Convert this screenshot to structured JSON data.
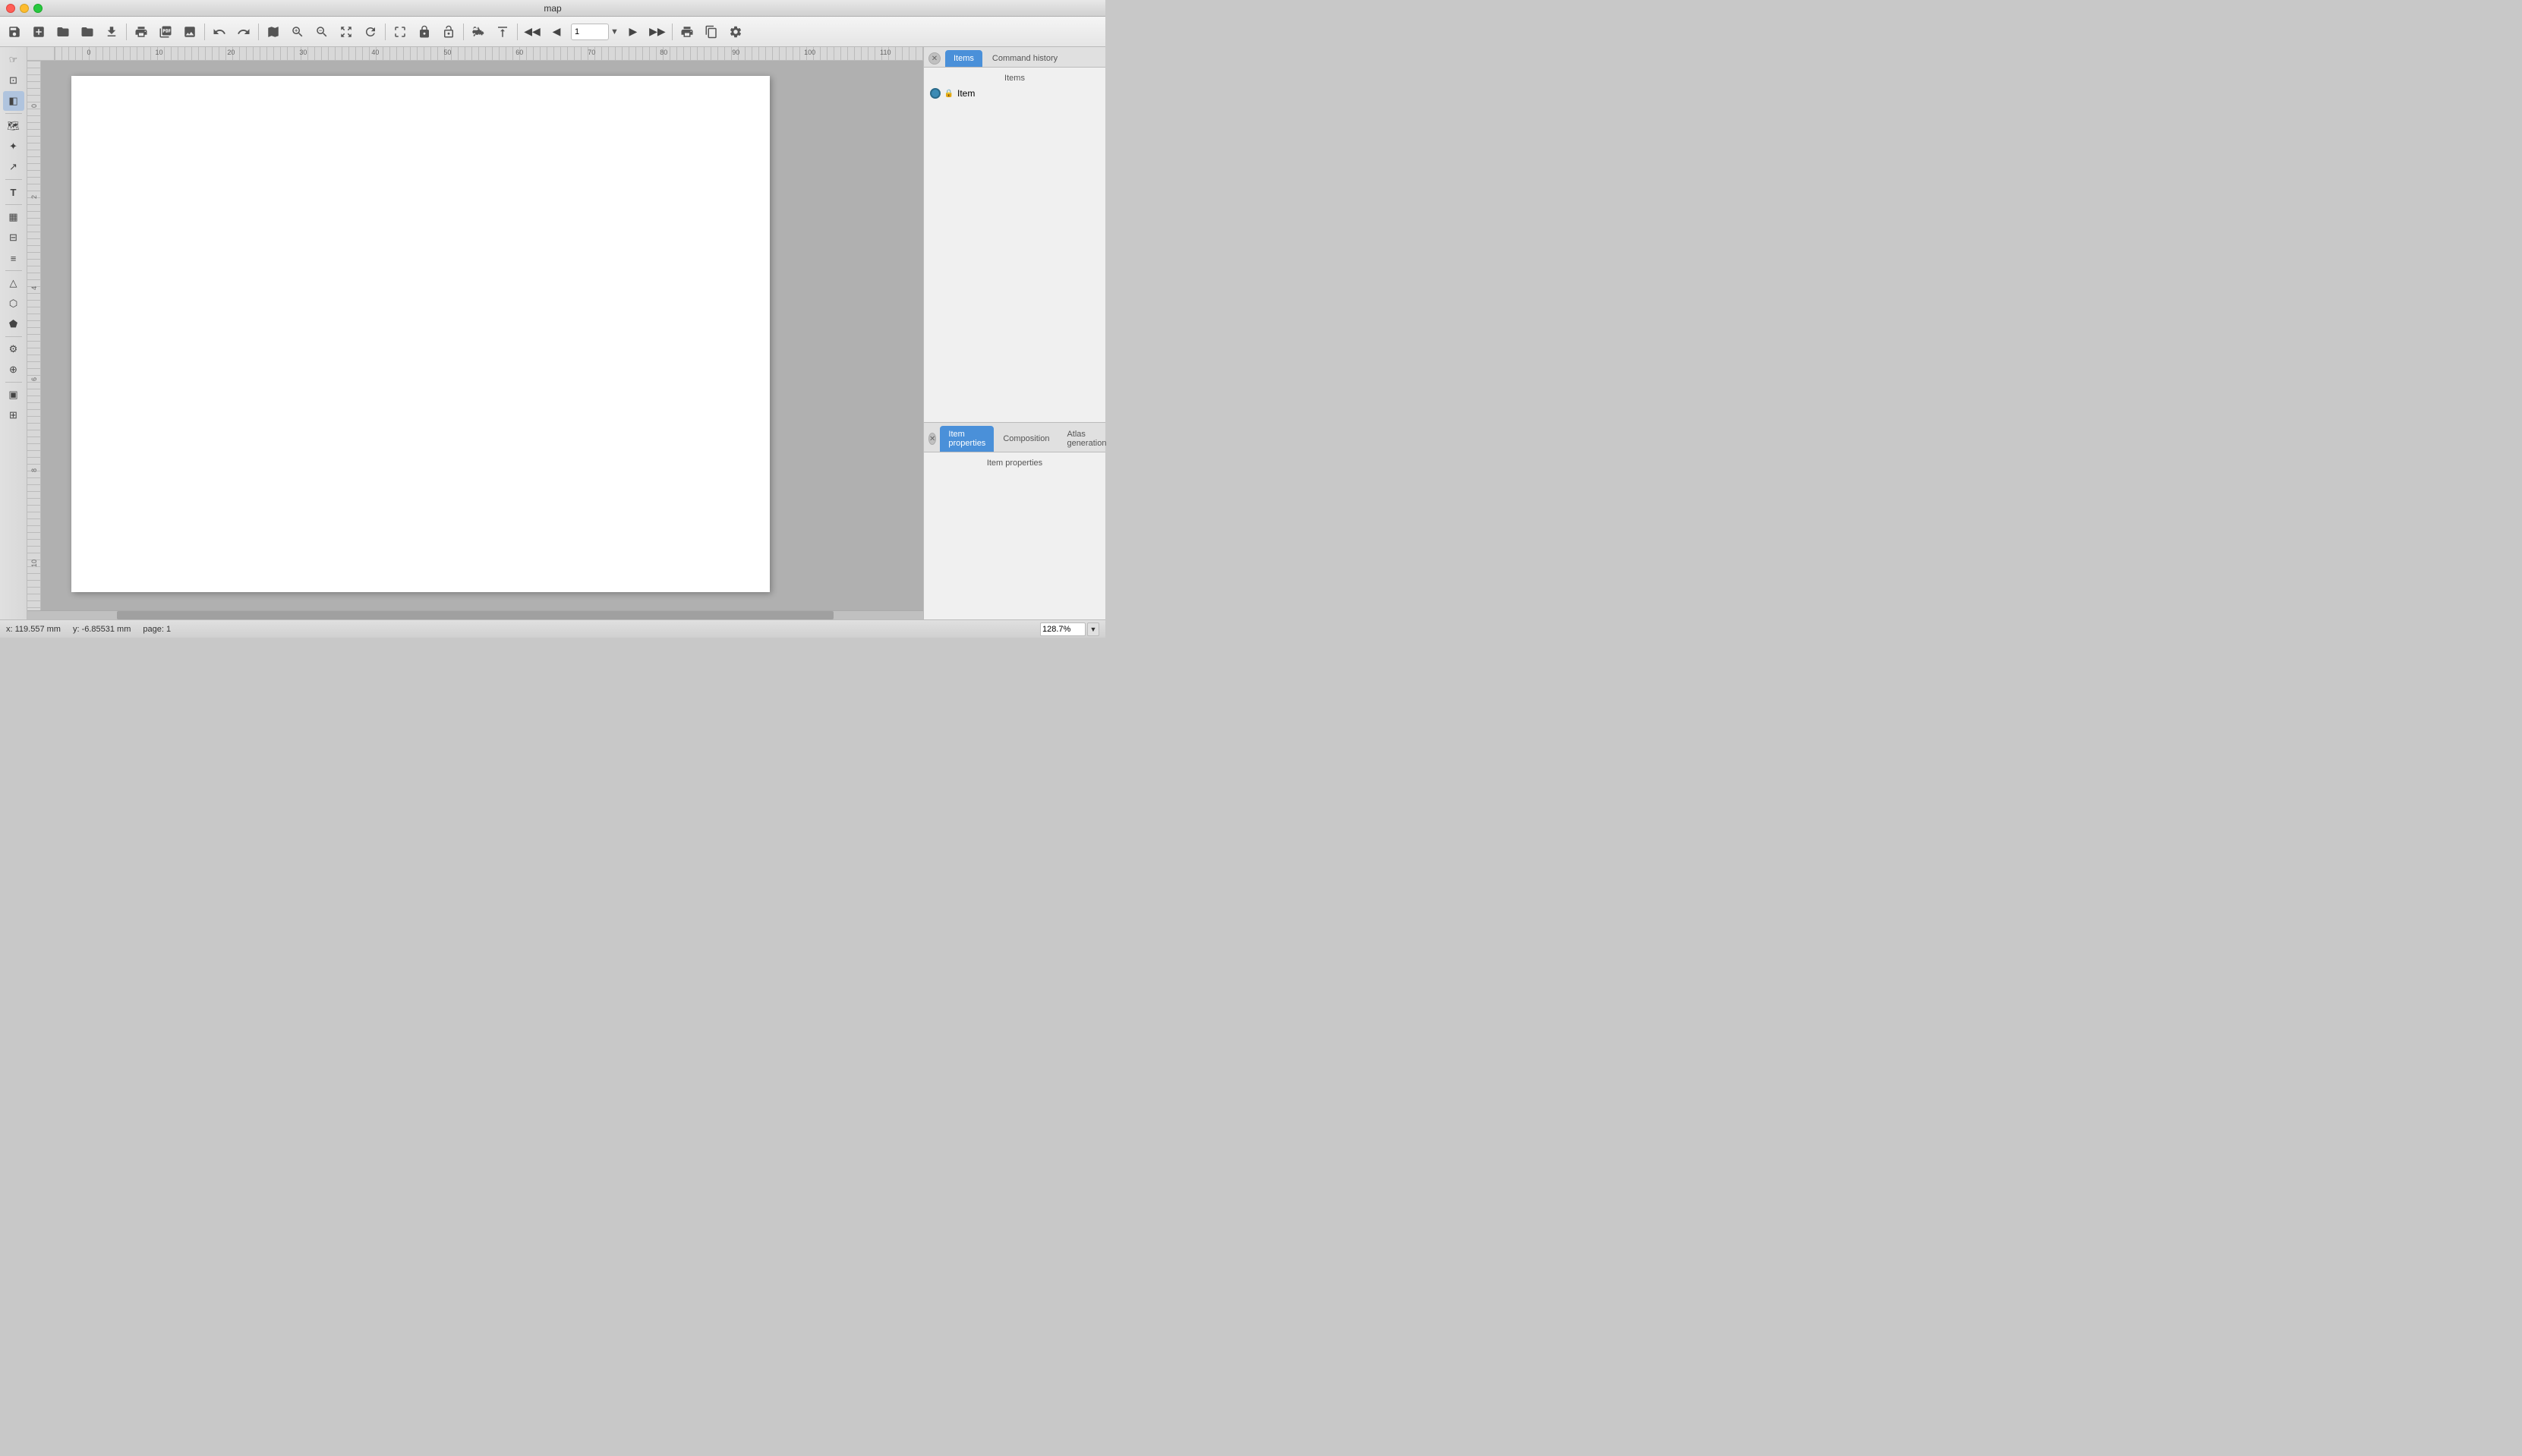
{
  "window": {
    "title": "map"
  },
  "toolbar": {
    "page_input": "1",
    "zoom_value": "128.7%"
  },
  "left_toolbar": {
    "tools": [
      {
        "name": "select-tool",
        "icon": "✥",
        "active": false
      },
      {
        "name": "pan-tool",
        "icon": "☞",
        "active": false
      },
      {
        "name": "select-item-tool",
        "icon": "▣",
        "active": true
      },
      {
        "name": "zoom-tool",
        "icon": "🔍",
        "active": false
      },
      {
        "name": "add-map-tool",
        "icon": "🗺",
        "active": false
      },
      {
        "name": "add-image-tool",
        "icon": "🖼",
        "active": false
      },
      {
        "name": "add-arrow-tool",
        "icon": "➤",
        "active": false
      },
      {
        "name": "add-label-tool",
        "icon": "T",
        "active": false
      },
      {
        "name": "add-table-tool",
        "icon": "▦",
        "active": false
      },
      {
        "name": "add-shape-tool",
        "icon": "△",
        "active": false
      },
      {
        "name": "add-node-tool",
        "icon": "⬡",
        "active": false
      },
      {
        "name": "add-html-tool",
        "icon": "⚙",
        "active": false
      }
    ]
  },
  "right_panel": {
    "tabs": [
      {
        "name": "items-tab",
        "label": "Items",
        "active": true
      },
      {
        "name": "command-history-tab",
        "label": "Command history",
        "active": false
      }
    ],
    "items_label": "Items",
    "items": [
      {
        "label": "Item"
      }
    ]
  },
  "bottom_panel": {
    "tabs": [
      {
        "name": "item-properties-tab",
        "label": "Item properties",
        "active": true
      },
      {
        "name": "composition-tab",
        "label": "Composition",
        "active": false
      },
      {
        "name": "atlas-generation-tab",
        "label": "Atlas generation",
        "active": false
      }
    ],
    "content_label": "Item properties"
  },
  "statusbar": {
    "x_coord": "x: 119.557 mm",
    "y_coord": "y: -6.85531 mm",
    "page": "page: 1",
    "zoom": "128.7%"
  },
  "colors": {
    "active_tab": "#4a90d9",
    "toolbar_bg": "#e8e8e8",
    "panel_bg": "#f0f0f0"
  }
}
